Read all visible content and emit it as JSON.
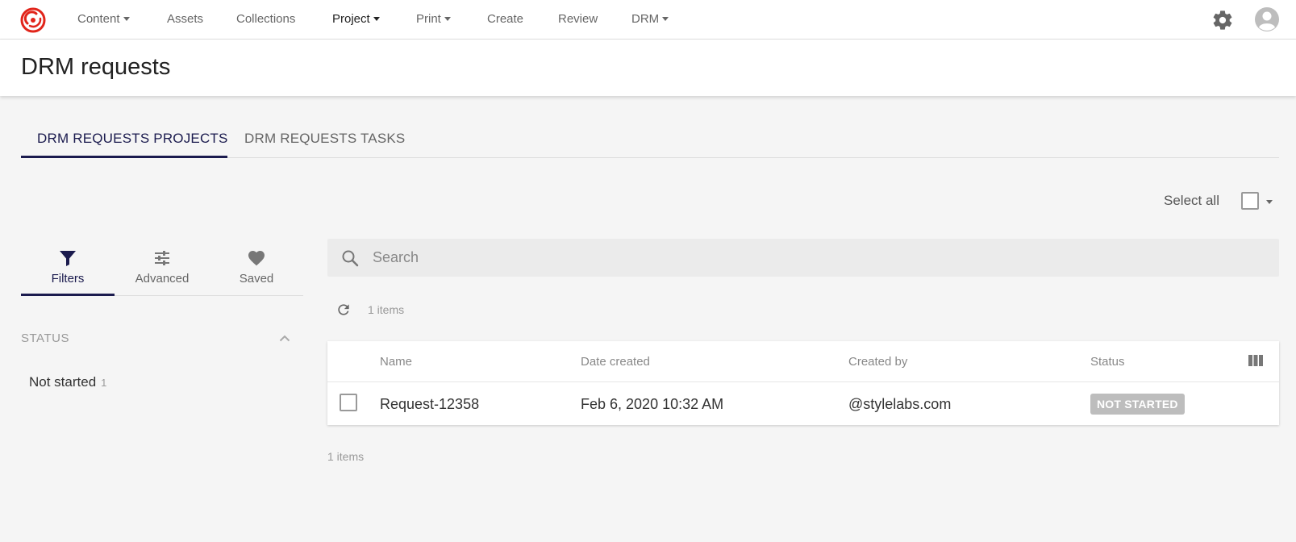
{
  "nav": {
    "items": [
      {
        "label": "Content",
        "dropdown": true
      },
      {
        "label": "Assets",
        "dropdown": false
      },
      {
        "label": "Collections",
        "dropdown": false
      },
      {
        "label": "Project",
        "dropdown": true,
        "active": true
      },
      {
        "label": "Print",
        "dropdown": true
      },
      {
        "label": "Create",
        "dropdown": false
      },
      {
        "label": "Review",
        "dropdown": false
      },
      {
        "label": "DRM",
        "dropdown": true
      }
    ],
    "icons": {
      "logo": "sitecore-logo",
      "settings": "gear-icon",
      "user": "avatar-icon"
    }
  },
  "page": {
    "title": "DRM requests"
  },
  "tabs": [
    {
      "label": "DRM REQUESTS PROJECTS",
      "active": true
    },
    {
      "label": "DRM REQUESTS TASKS",
      "active": false
    }
  ],
  "selection": {
    "select_all_label": "Select all"
  },
  "filter_panel": {
    "tabs": [
      {
        "label": "Filters",
        "icon": "filter-icon",
        "active": true
      },
      {
        "label": "Advanced",
        "icon": "sliders-icon",
        "active": false
      },
      {
        "label": "Saved",
        "icon": "heart-icon",
        "active": false
      }
    ],
    "facet_heading": "STATUS",
    "facets": [
      {
        "label": "Not started",
        "count": "1"
      }
    ]
  },
  "search": {
    "placeholder": "Search",
    "value": ""
  },
  "results": {
    "count_label": "1 items",
    "columns": [
      "Name",
      "Date created",
      "Created by",
      "Status"
    ],
    "rows": [
      {
        "name": "Request-12358",
        "date_created": "Feb 6, 2020 10:32 AM",
        "created_by": "@stylelabs.com",
        "status": "NOT STARTED"
      }
    ]
  },
  "colors": {
    "accent": "#1b1b4e",
    "brand": "#e1251b",
    "badge_bg": "#bdbdbd",
    "page_bg": "#f5f5f5"
  }
}
